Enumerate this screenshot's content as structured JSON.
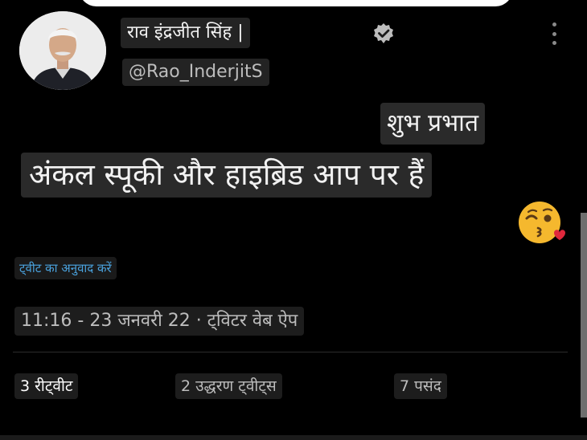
{
  "profile": {
    "display_name": "राव इंद्रजीत सिंह |",
    "handle": "@Rao_InderjitS",
    "verified_icon": "verified-badge-icon",
    "more_icon": "more-options-icon"
  },
  "tweet": {
    "greeting": "शुभ प्रभात",
    "text": "अंकल स्पूकी और हाइब्रिड आप पर हैं",
    "emoji": "😘",
    "translate_label": "ट्वीट का अनुवाद करें",
    "meta": "11:16 - 23 जनवरी 22 · ट्विटर वेब ऐप"
  },
  "stats": {
    "retweets": "3 रीट्वीट",
    "quote_tweets": "2 उद्धरण ट्वीट्स",
    "likes": "7 पसंद"
  },
  "colors": {
    "background": "#000000",
    "link": "#4aa3df"
  }
}
